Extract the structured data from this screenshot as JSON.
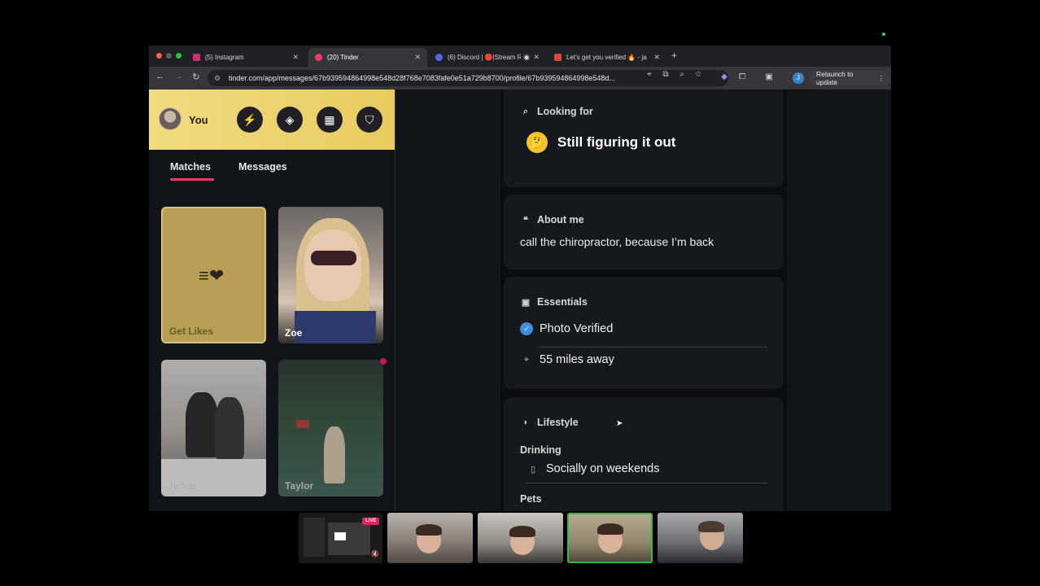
{
  "tabs": [
    {
      "label": "(5) Instagram",
      "favicon_color": "#d62976"
    },
    {
      "label": "(20) Tinder",
      "favicon_color": "#fd3563"
    },
    {
      "label": "(6) Discord | 🔴|Stream R",
      "favicon_color": "#5865f2"
    },
    {
      "label": "Let's get you verified 🔥 - ja",
      "favicon_color": "#ea4335"
    }
  ],
  "url": "tinder.com/app/messages/67b939594864998e548d28f768e7083fafe0e51a729b8700/profile/67b939594864998e548d...",
  "relaunch_label": "Relaunch to update",
  "profile_initial": "J",
  "sidebar": {
    "user_label": "You",
    "tabs": {
      "matches": "Matches",
      "messages": "Messages"
    },
    "cards": {
      "get_likes": "Get Likes",
      "zoe": "Zoe",
      "jaden": "Jaden",
      "taylor": "Taylor"
    }
  },
  "profile": {
    "looking_for": {
      "title": "Looking for",
      "value": "Still figuring it out",
      "emoji": "🤔"
    },
    "about": {
      "title": "About me",
      "text": "call the chiropractor, because I’m back"
    },
    "essentials": {
      "title": "Essentials",
      "verified": "Photo Verified",
      "distance": "55 miles away"
    },
    "lifestyle": {
      "title": "Lifestyle",
      "drinking_label": "Drinking",
      "drinking_value": "Socially on weekends",
      "pets_label": "Pets"
    }
  },
  "video_strip": {
    "live_label": "LIVE"
  },
  "colors": {
    "tinder_accent": "#fd3563",
    "header_gold": "#f0d77a"
  }
}
